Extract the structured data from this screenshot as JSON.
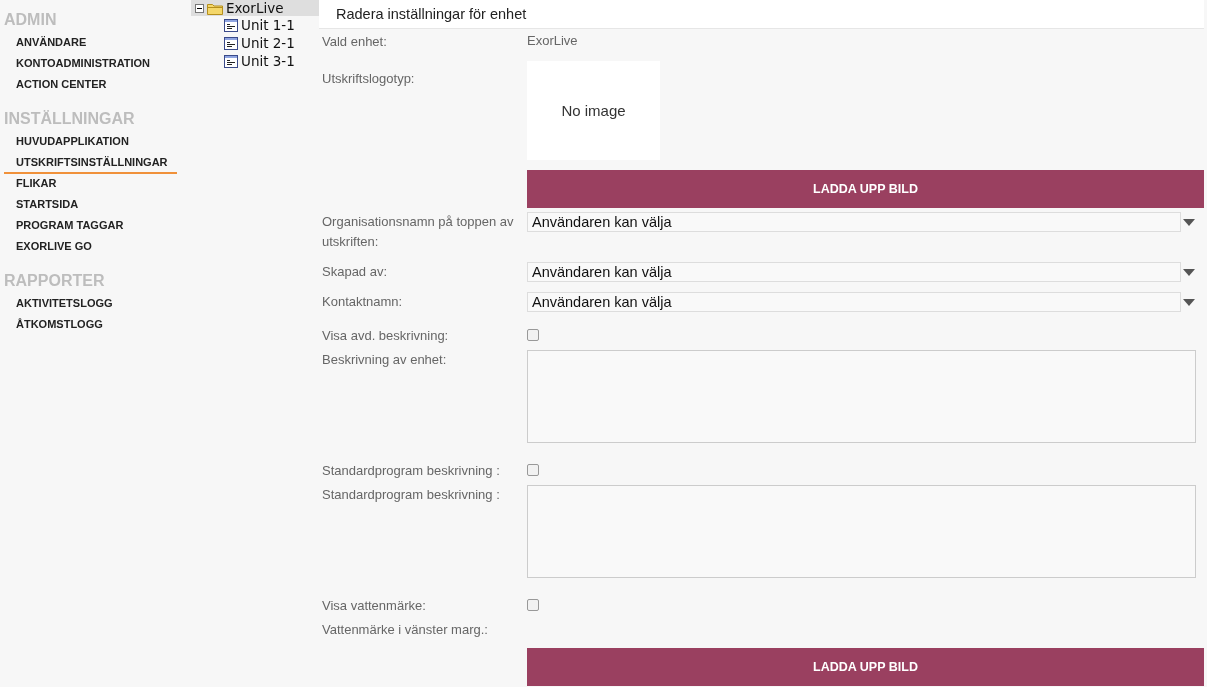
{
  "sidebar": {
    "sections": [
      {
        "title": "ADMIN",
        "items": [
          {
            "label": "ANVÄNDARE",
            "selected": false
          },
          {
            "label": "KONTOADMINISTRATION",
            "selected": false
          },
          {
            "label": "ACTION CENTER",
            "selected": false
          }
        ]
      },
      {
        "title": "INSTÄLLNINGAR",
        "items": [
          {
            "label": "HUVUDAPPLIKATION",
            "selected": false
          },
          {
            "label": "UTSKRIFTSINSTÄLLNINGAR",
            "selected": true
          },
          {
            "label": "FLIKAR",
            "selected": false
          },
          {
            "label": "STARTSIDA",
            "selected": false
          },
          {
            "label": "PROGRAM TAGGAR",
            "selected": false
          },
          {
            "label": "EXORLIVE GO",
            "selected": false
          }
        ]
      },
      {
        "title": "RAPPORTER",
        "items": [
          {
            "label": "AKTIVITETSLOGG",
            "selected": false
          },
          {
            "label": "ÅTKOMSTLOGG",
            "selected": false
          }
        ]
      }
    ]
  },
  "tree": {
    "label": "ExorLive",
    "selected": true,
    "expanded": true,
    "children": [
      {
        "label": "Unit 1-1",
        "selected": false
      },
      {
        "label": "Unit 2-1",
        "selected": false
      },
      {
        "label": "Unit 3-1",
        "selected": false
      }
    ]
  },
  "header": {
    "title": "Radera inställningar för enhet"
  },
  "form": [
    {
      "kind": "text",
      "label": "Vald enhet:",
      "value": "ExorLive"
    },
    {
      "kind": "logo",
      "label": "Utskriftslogotyp:",
      "placeholder": "No image"
    },
    {
      "kind": "button",
      "label": "LADDA UPP BILD"
    },
    {
      "kind": "select",
      "label": "Organisationsnamn på toppen av utskriften:",
      "value": "Användaren kan välja"
    },
    {
      "kind": "select",
      "label": "Skapad av:",
      "value": "Användaren kan välja"
    },
    {
      "kind": "select",
      "label": "Kontaktnamn:",
      "value": "Användaren kan välja"
    },
    {
      "kind": "checkbox",
      "label": "Visa avd. beskrivning:",
      "checked": false
    },
    {
      "kind": "textarea",
      "label": "Beskrivning av enhet:"
    },
    {
      "kind": "checkbox",
      "label": "Standardprogram beskrivning :",
      "checked": false
    },
    {
      "kind": "textarea",
      "label": "Standardprogram beskrivning :"
    },
    {
      "kind": "checkbox",
      "label": "Visa vattenmärke:",
      "checked": false
    },
    {
      "kind": "label",
      "label": "Vattenmärke i vänster marg.:"
    },
    {
      "kind": "button",
      "label": "LADDA UPP BILD"
    }
  ]
}
